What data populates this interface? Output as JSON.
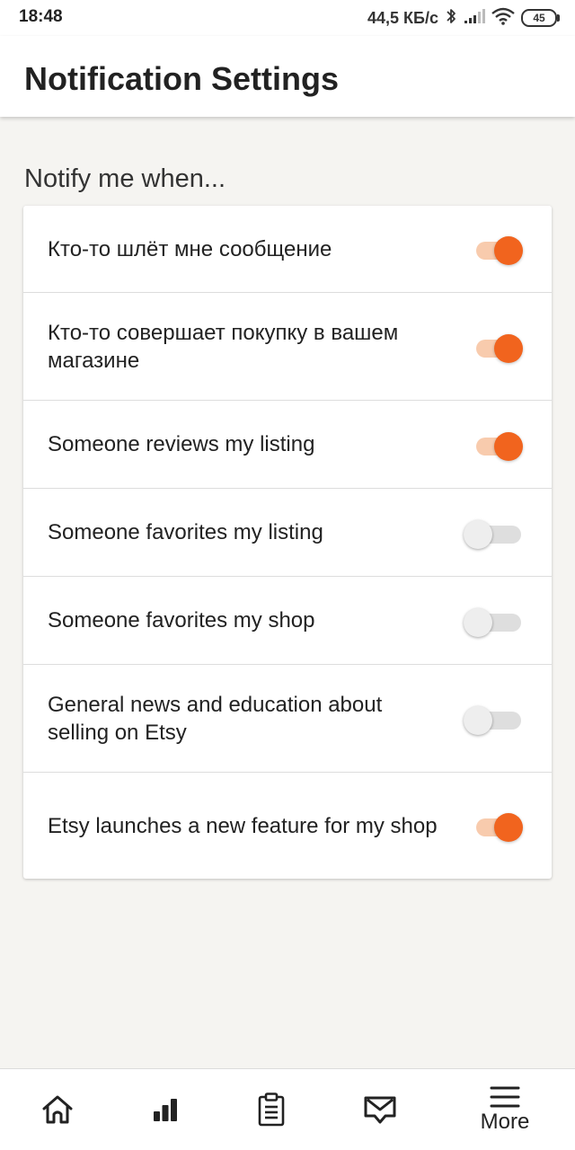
{
  "status_bar": {
    "time": "18:48",
    "net_speed": "44,5 КБ/с",
    "battery": "45"
  },
  "header": {
    "title": "Notification Settings"
  },
  "section": {
    "label": "Notify me when..."
  },
  "settings": [
    {
      "label": "Кто-то шлёт мне сообщение",
      "enabled": true
    },
    {
      "label": "Кто-то совершает покупку в вашем магазине",
      "enabled": true
    },
    {
      "label": "Someone reviews my listing",
      "enabled": true
    },
    {
      "label": "Someone favorites my listing",
      "enabled": false
    },
    {
      "label": "Someone favorites my shop",
      "enabled": false
    },
    {
      "label": "General news and education about selling on Etsy",
      "enabled": false
    },
    {
      "label": "Etsy launches a new feature for my shop",
      "enabled": true
    }
  ],
  "bottom_nav": {
    "items": [
      {
        "icon": "home-icon"
      },
      {
        "icon": "stats-icon"
      },
      {
        "icon": "orders-icon"
      },
      {
        "icon": "messages-icon"
      },
      {
        "icon": "menu-icon",
        "label": "More"
      }
    ]
  },
  "colors": {
    "accent": "#f1641e",
    "accent_track": "#f8cbad",
    "background": "#f5f4f1"
  }
}
